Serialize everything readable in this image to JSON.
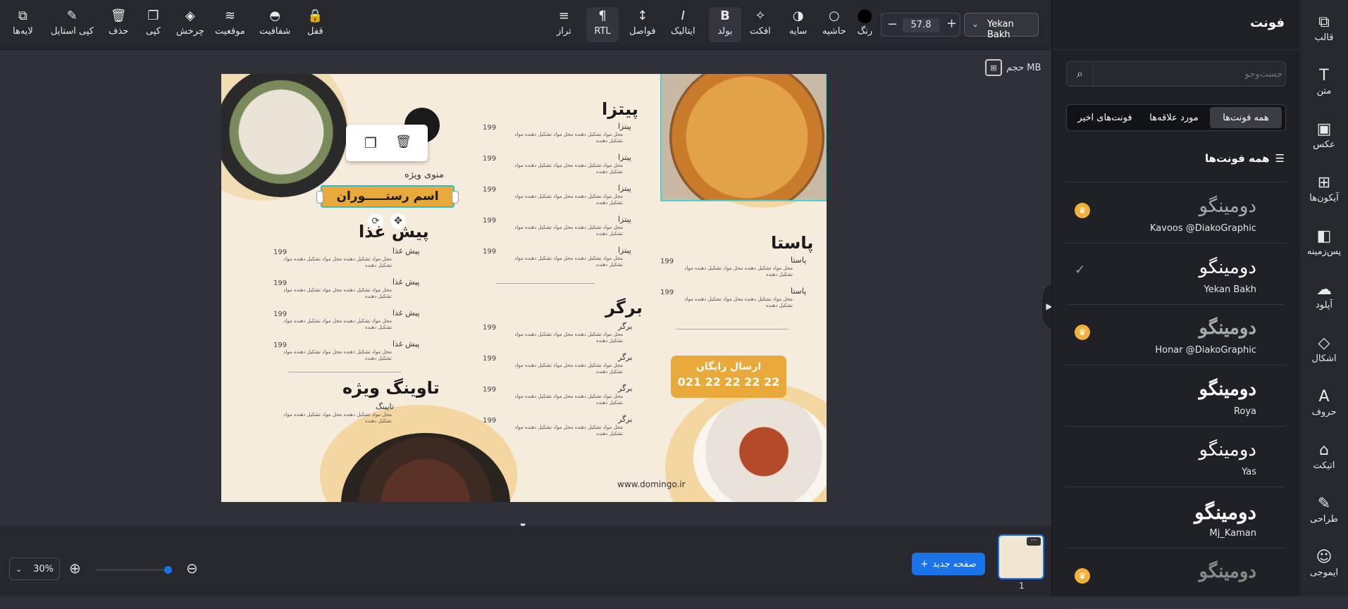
{
  "toolbar": {
    "left_tools": [
      {
        "id": "layers",
        "label": "لایه‌ها",
        "icon": "layers-icon",
        "glyph": "⧉"
      },
      {
        "id": "copy-style",
        "label": "کپی استایل",
        "icon": "brush-icon",
        "glyph": "✎"
      },
      {
        "id": "delete",
        "label": "حذف",
        "icon": "trash-icon",
        "glyph": "🗑"
      },
      {
        "id": "copy",
        "label": "کپی",
        "icon": "copy-icon",
        "glyph": "❐"
      },
      {
        "id": "rotate",
        "label": "چرخش",
        "icon": "rotate-icon",
        "glyph": "◈"
      },
      {
        "id": "position",
        "label": "موقعیت",
        "icon": "stack-icon",
        "glyph": "≋"
      },
      {
        "id": "opacity",
        "label": "شفافیت",
        "icon": "droplet-icon",
        "glyph": "◓"
      },
      {
        "id": "lock",
        "label": "قفل",
        "icon": "lock-icon",
        "glyph": "🔒"
      }
    ],
    "right_tools": [
      {
        "id": "align",
        "label": "تراز",
        "icon": "align-icon",
        "glyph": "≡"
      },
      {
        "id": "rtl",
        "label": "RTL",
        "icon": "rtl-icon",
        "glyph": "¶"
      },
      {
        "id": "spacing",
        "label": "فواصل",
        "icon": "spacing-icon",
        "glyph": "↕"
      },
      {
        "id": "italic",
        "label": "ایتالیک",
        "icon": "italic-icon",
        "glyph": "I"
      },
      {
        "id": "bold",
        "label": "بولد",
        "icon": "bold-icon",
        "glyph": "B"
      },
      {
        "id": "effect",
        "label": "افکت",
        "icon": "magic-wand-icon",
        "glyph": "✧"
      },
      {
        "id": "shadow",
        "label": "سایه",
        "icon": "shadow-icon",
        "glyph": "◑"
      },
      {
        "id": "border",
        "label": "حاشیه",
        "icon": "border-icon",
        "glyph": "○"
      },
      {
        "id": "color",
        "label": "رنگ",
        "icon": "color-swatch-icon",
        "glyph": "●"
      }
    ],
    "font_size": "57.8",
    "font_family": "Yekan Bakh",
    "file_size_label": "حجم MB"
  },
  "panel": {
    "title": "فونت",
    "search_placeholder": "جست‌وجو",
    "tabs": [
      "همه فونت‌ها",
      "مورد علاقه‌ها",
      "فونت‌های اخیر"
    ],
    "section_title": "همه فونت‌ها",
    "fonts": [
      {
        "sample": "دومینگو",
        "name": "Kavoos @DiakoGraphic",
        "badge": "crown"
      },
      {
        "sample": "دومینگو",
        "name": "Yekan Bakh",
        "badge": "check"
      },
      {
        "sample": "دومینگو",
        "name": "Honar @DiakoGraphic",
        "badge": "crown"
      },
      {
        "sample": "دومینگو",
        "name": "Roya",
        "badge": ""
      },
      {
        "sample": "دومینگو",
        "name": "Yas",
        "badge": ""
      },
      {
        "sample": "دومینگو",
        "name": "Mj_Kaman",
        "badge": ""
      },
      {
        "sample": "دومینگو",
        "name": "",
        "badge": "crown"
      }
    ]
  },
  "rail": [
    {
      "label": "قالب",
      "icon": "template-icon",
      "glyph": "⧉"
    },
    {
      "label": "متن",
      "icon": "text-icon",
      "glyph": "T"
    },
    {
      "label": "عکس",
      "icon": "image-icon",
      "glyph": "▣"
    },
    {
      "label": "آیکون‌ها",
      "icon": "grid-icon",
      "glyph": "⊞"
    },
    {
      "label": "پس‌زمینه",
      "icon": "background-icon",
      "glyph": "◧"
    },
    {
      "label": "آپلود",
      "icon": "upload-icon",
      "glyph": "☁"
    },
    {
      "label": "اشکال",
      "icon": "shapes-icon",
      "glyph": "◇"
    },
    {
      "label": "حروف",
      "icon": "letters-icon",
      "glyph": "A"
    },
    {
      "label": "اتیکت",
      "icon": "tag-icon",
      "glyph": "⌂"
    },
    {
      "label": "طراحی",
      "icon": "pencil-icon",
      "glyph": "✎"
    },
    {
      "label": "ایموجی",
      "icon": "emoji-icon",
      "glyph": "☺"
    }
  ],
  "bottom": {
    "zoom": "30%",
    "new_page": "صفحه جدید",
    "page_number": "1"
  },
  "menu": {
    "special_menu": "منوی ویژه",
    "restaurant_name": "اسم رستـــــوران",
    "sections": {
      "appetizer": {
        "title": "پیش غذا",
        "item": "پیش غذا"
      },
      "special": {
        "title": "تاوینگ ویژه",
        "item": "تاپینگ"
      },
      "pizza": {
        "title": "پیتزا",
        "item": "پیتزا"
      },
      "burger": {
        "title": "برگر",
        "item": "برگر"
      },
      "pasta": {
        "title": "پاستا",
        "item": "پاستا"
      }
    },
    "desc": "محل مواد تشکیل دهنده محل مواد تشکیل دهنده مواد تشکیل دهنده",
    "price": "199",
    "delivery_title": "ارسال رایگان",
    "delivery_phone": "021 22 22 22 22",
    "website": "www.domingo.ir"
  }
}
